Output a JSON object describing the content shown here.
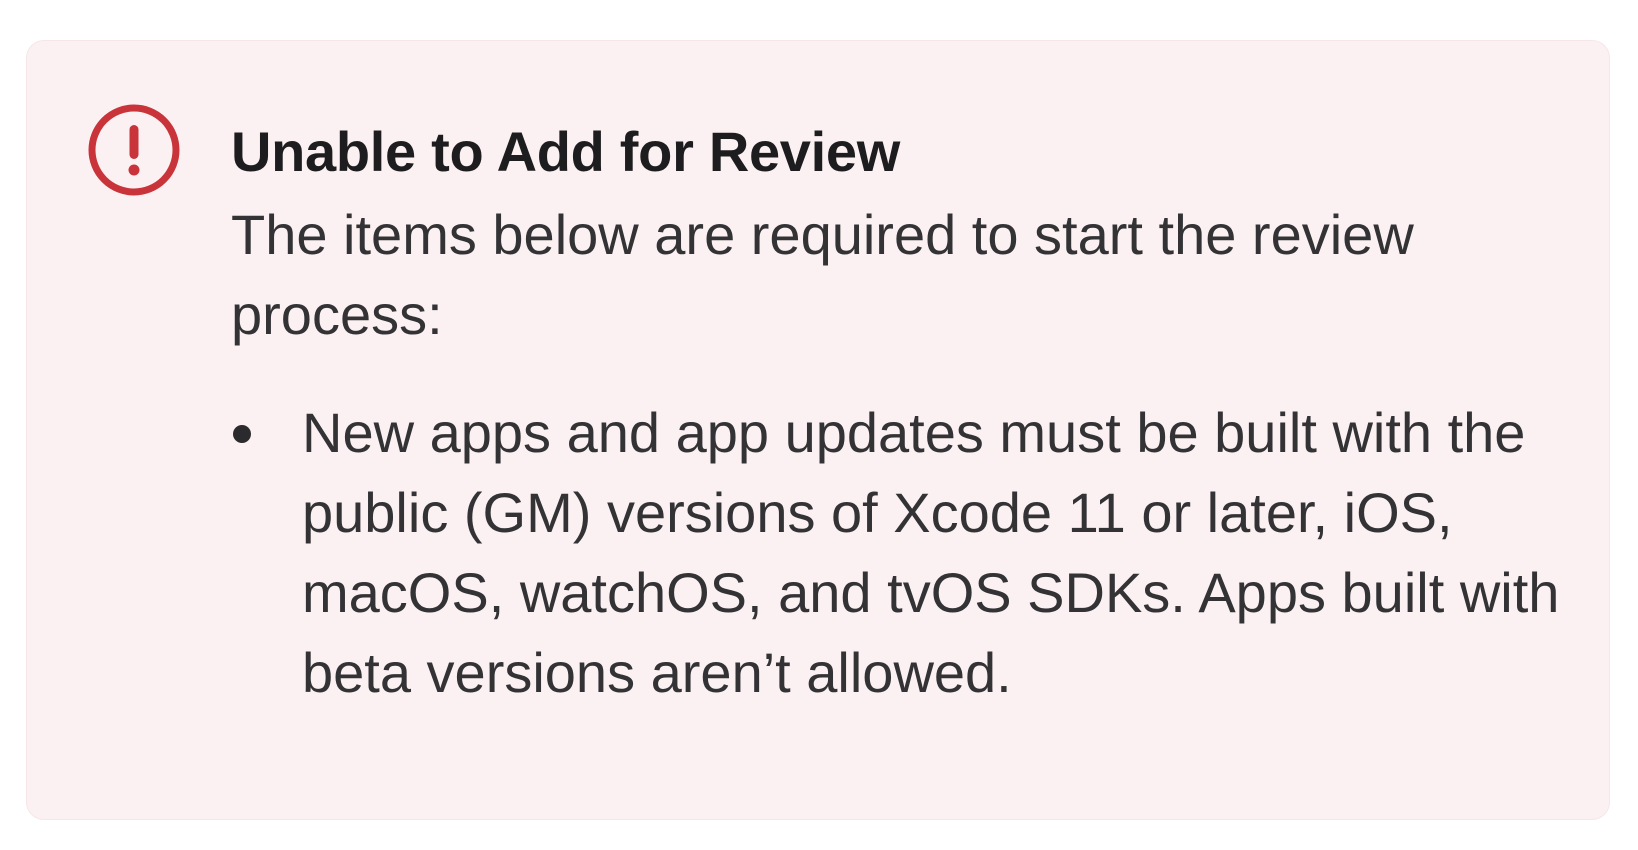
{
  "alert": {
    "icon": "exclamation-circle-icon",
    "icon_color": "#c9343a",
    "background_color": "#fcf1f2",
    "title": "Unable to Add for Review",
    "description": "The items below are required to start the review process:",
    "requirements": [
      "New apps and app updates must be built with the public (GM) versions of Xcode 11 or later, iOS, macOS, watchOS, and tvOS SDKs. Apps built with beta versions aren’t allowed."
    ]
  }
}
